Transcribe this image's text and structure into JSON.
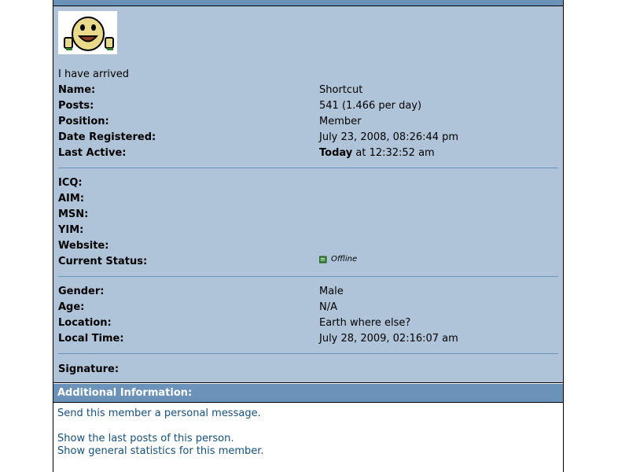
{
  "profile": {
    "avatar_icon": "smiley-avatar-icon",
    "personal_text": "I have arrived",
    "basic": [
      {
        "label": "Name:",
        "value": "Shortcut"
      },
      {
        "label": "Posts:",
        "value": "541 (1.466 per day)"
      },
      {
        "label": "Position:",
        "value": "Member"
      },
      {
        "label": "Date Registered:",
        "value": "July 23, 2008, 08:26:44 pm"
      }
    ],
    "last_active": {
      "label": "Last Active:",
      "value_bold": "Today",
      "value_rest": " at 12:32:52 am"
    },
    "contact": [
      {
        "label": "ICQ:"
      },
      {
        "label": "AIM:"
      },
      {
        "label": "MSN:"
      },
      {
        "label": "YIM:"
      },
      {
        "label": "Website:"
      }
    ],
    "current_status": {
      "label": "Current Status:",
      "value": "Offline",
      "icon": "offline-status-icon"
    },
    "personal": [
      {
        "label": "Gender:",
        "value": "Male"
      },
      {
        "label": "Age:",
        "value": "N/A"
      },
      {
        "label": "Location:",
        "value": "Earth where else?"
      },
      {
        "label": "Local Time:",
        "value": "July 28, 2009, 02:16:07 am"
      }
    ],
    "signature_label": "Signature:"
  },
  "additional": {
    "header": "Additional Information:",
    "links": [
      "Send this member a personal message.",
      "Show the last posts of this person.",
      "Show general statistics for this member."
    ]
  },
  "colors": {
    "header_bg": "#6b93b9",
    "panel_bg": "#b0c4d9",
    "link": "#145081"
  }
}
